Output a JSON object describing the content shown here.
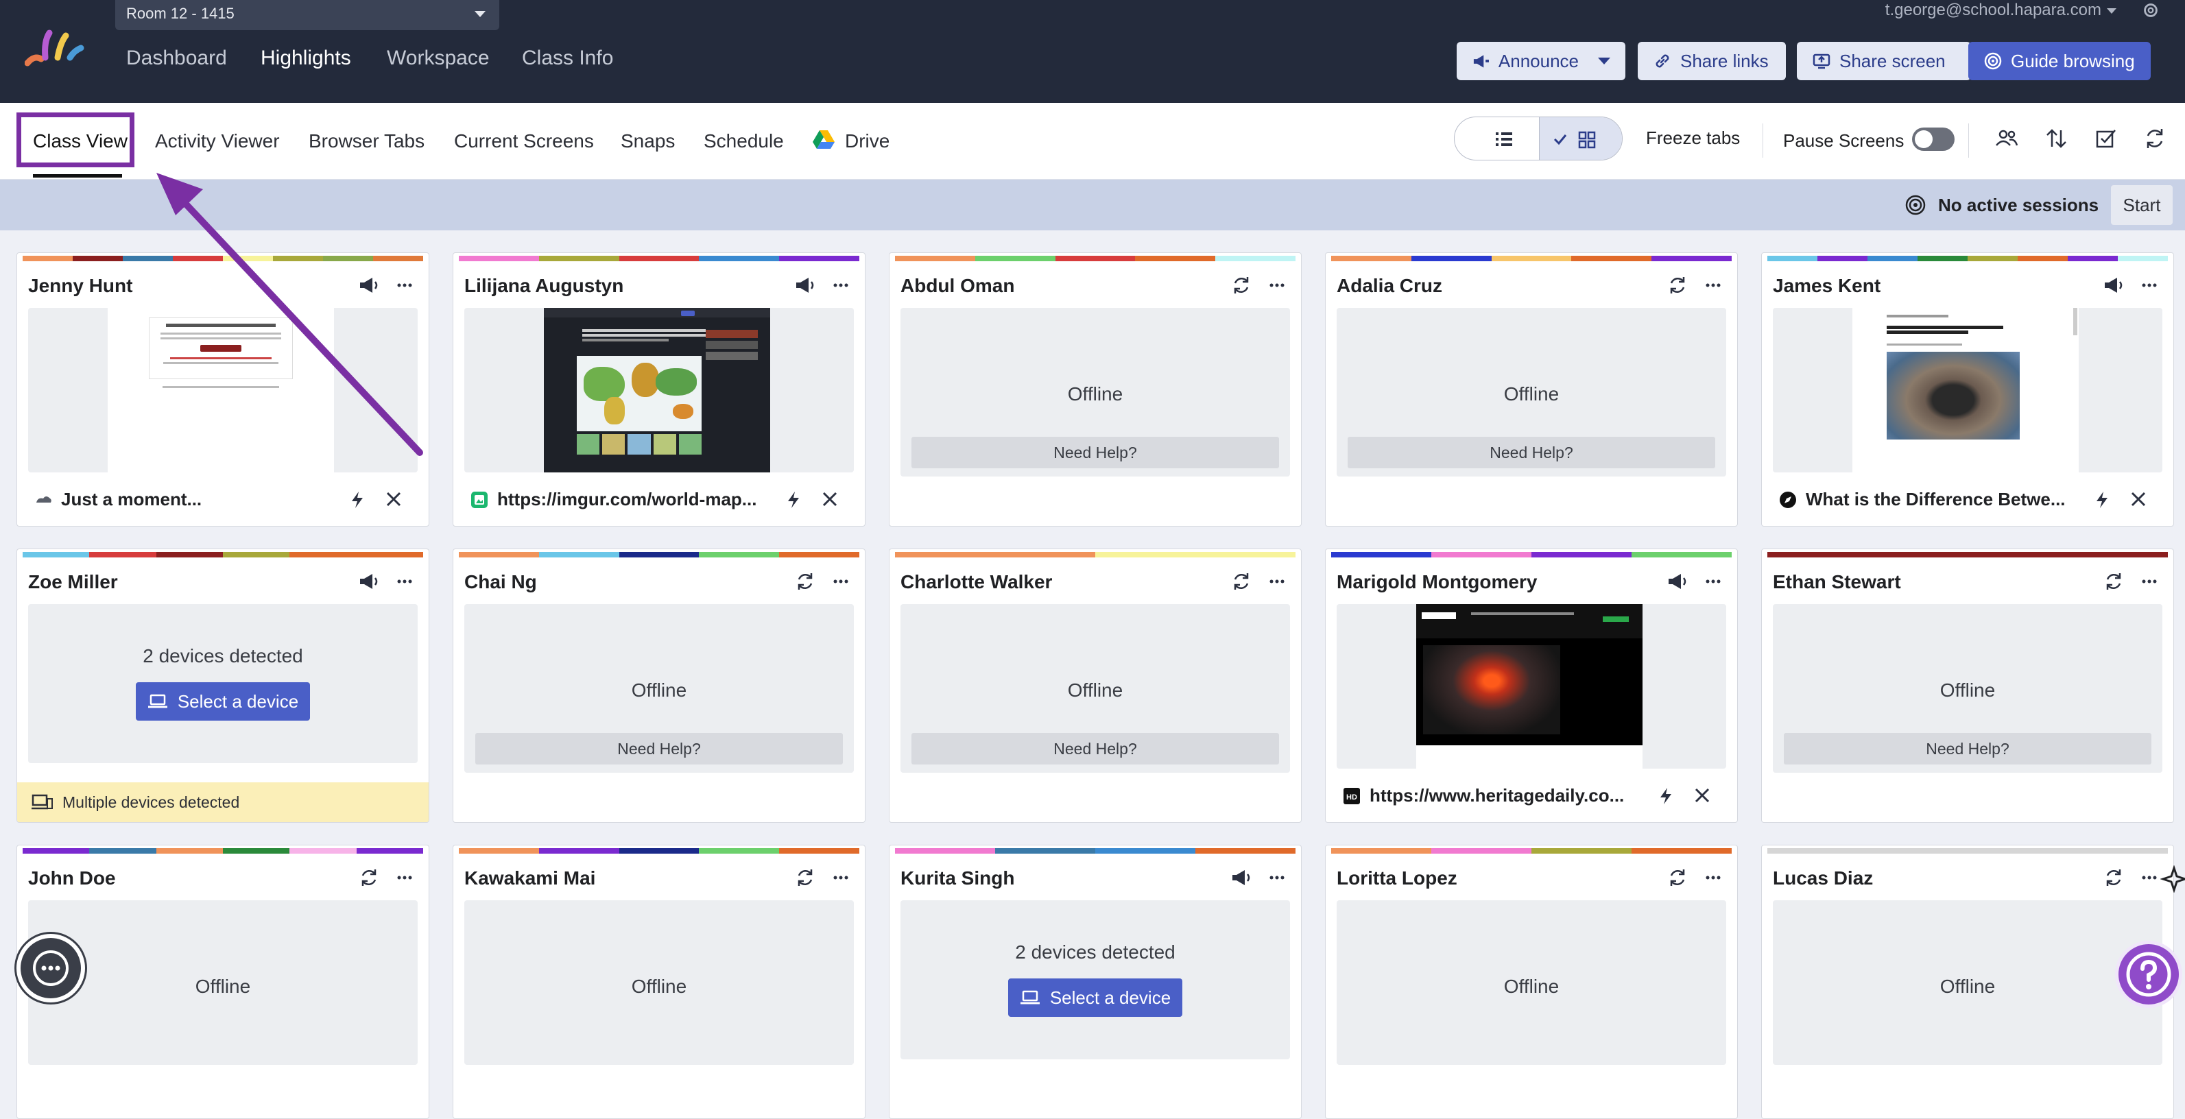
{
  "header": {
    "room": "Room 12 - 1415",
    "nav": [
      "Dashboard",
      "Highlights",
      "Workspace",
      "Class Info"
    ],
    "active_nav": "Highlights",
    "user_email": "t.george@school.hapara.com",
    "buttons": {
      "announce": "Announce",
      "share_links": "Share links",
      "share_screen": "Share screen",
      "guide_browsing": "Guide browsing"
    }
  },
  "tabs": {
    "items": [
      "Class View",
      "Activity Viewer",
      "Browser Tabs",
      "Current Screens",
      "Snaps",
      "Schedule",
      "Drive"
    ],
    "active": "Class View",
    "freeze_tabs": "Freeze tabs",
    "pause_screens": "Pause Screens",
    "pause_enabled": false
  },
  "session": {
    "status": "No active sessions",
    "start": "Start"
  },
  "students": [
    {
      "name": "Jenny Hunt",
      "state": "online",
      "tab_title": "Just a moment...",
      "preview": "verification",
      "favicon": "cloudflare-icon",
      "icon": "megaphone-icon",
      "colors": [
        "#f0935a",
        "#8b1f1f",
        "#3a7aa8",
        "#d73c3c",
        "#f7f39a",
        "#a8a83a",
        "#88a84a",
        "#e07a3a"
      ]
    },
    {
      "name": "Lilijana Augustyn",
      "state": "online",
      "tab_title": "https://imgur.com/world-map...",
      "preview": "map",
      "favicon": "imgur-icon",
      "icon": "megaphone-icon",
      "colors": [
        "#f17ad0",
        "#a8a83a",
        "#d73c3c",
        "#3a8ad0",
        "#7a2ad0"
      ]
    },
    {
      "name": "Abdul Oman",
      "state": "offline",
      "offline": "Offline",
      "help": "Need Help?",
      "icon": "refresh-icon",
      "colors": [
        "#f0935a",
        "#6cd06c",
        "#d73c3c",
        "#e06a2a",
        "#bff4f4"
      ]
    },
    {
      "name": "Adalia Cruz",
      "state": "offline",
      "offline": "Offline",
      "help": "Need Help?",
      "icon": "refresh-icon",
      "colors": [
        "#f0935a",
        "#2a3ad0",
        "#f7c56a",
        "#e06a2a",
        "#7a2ad0"
      ]
    },
    {
      "name": "James Kent",
      "state": "online",
      "tab_title": "What is the Difference Betwe...",
      "preview": "volcano-article",
      "favicon": "compass-icon",
      "icon": "megaphone-icon",
      "colors": [
        "#6ac6e8",
        "#7a2ad0",
        "#3a8ad0",
        "#2a8a3a",
        "#a8a83a",
        "#e06a2a",
        "#7a2ad0",
        "#bff4f4"
      ]
    },
    {
      "name": "Zoe Miller",
      "state": "multi",
      "detected": "2 devices detected",
      "select": "Select a device",
      "banner": "Multiple devices detected",
      "icon": "megaphone-icon",
      "colors": [
        "#6ac6e8",
        "#d73c3c",
        "#8b1f1f",
        "#a8a83a",
        "#e06a2a",
        "#e06a2a"
      ]
    },
    {
      "name": "Chai Ng",
      "state": "offline",
      "offline": "Offline",
      "help": "Need Help?",
      "icon": "refresh-icon",
      "colors": [
        "#f0935a",
        "#6ac6e8",
        "#1a2a8a",
        "#6cd06c",
        "#e06a2a"
      ]
    },
    {
      "name": "Charlotte Walker",
      "state": "offline",
      "offline": "Offline",
      "help": "Need Help?",
      "icon": "refresh-icon",
      "colors": [
        "#f0935a",
        "#f7f39a"
      ]
    },
    {
      "name": "Marigold Montgomery",
      "state": "online",
      "tab_title": "https://www.heritagedaily.co...",
      "preview": "heritage",
      "favicon": "hd-icon",
      "icon": "megaphone-icon",
      "colors": [
        "#2a3ad0",
        "#f17ad0",
        "#7a2ad0",
        "#6cd06c"
      ]
    },
    {
      "name": "Ethan Stewart",
      "state": "offline",
      "offline": "Offline",
      "help": "Need Help?",
      "icon": "refresh-icon",
      "colors": [
        "#8b1f1f"
      ]
    },
    {
      "name": "John Doe",
      "state": "offline",
      "offline": "Offline",
      "icon": "refresh-icon",
      "colors": [
        "#7a2ad0",
        "#3a7aa8",
        "#f0935a",
        "#2a8a3a",
        "#f7b3e8",
        "#7a2ad0"
      ]
    },
    {
      "name": "Kawakami Mai",
      "state": "offline",
      "offline": "Offline",
      "icon": "refresh-icon",
      "colors": [
        "#f0935a",
        "#7a2ad0",
        "#1a2a8a",
        "#6cd06c",
        "#e06a2a"
      ]
    },
    {
      "name": "Kurita Singh",
      "state": "multi-nobanner",
      "detected": "2 devices detected",
      "select": "Select a device",
      "icon": "megaphone-icon",
      "colors": [
        "#f17ad0",
        "#3a7aa8",
        "#3a8ad0",
        "#e06a2a"
      ]
    },
    {
      "name": "Loritta Lopez",
      "state": "offline",
      "offline": "Offline",
      "icon": "refresh-icon",
      "colors": [
        "#f0935a",
        "#f17ad0",
        "#a8a83a",
        "#e06a2a"
      ]
    },
    {
      "name": "Lucas Diaz",
      "state": "offline",
      "offline": "Offline",
      "icon": "refresh-icon",
      "colors": [
        "#d6d6d6"
      ]
    }
  ],
  "colors": {
    "nav_bg": "#232a3b",
    "accent": "#4a5fc7",
    "highlight": "#7a2fa3"
  }
}
